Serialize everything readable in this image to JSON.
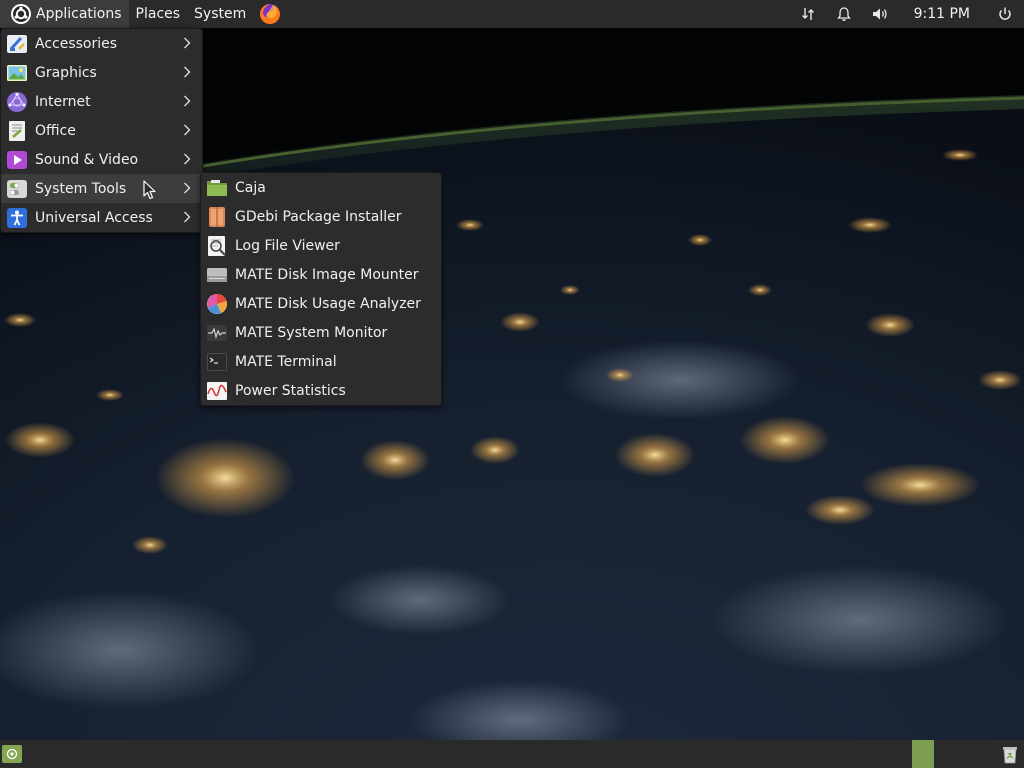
{
  "top_panel": {
    "menus": [
      "Applications",
      "Places",
      "System"
    ],
    "clock": "9:11 PM",
    "tray_icons": [
      "network-icon",
      "notification-bell-icon",
      "volume-icon",
      "power-icon"
    ]
  },
  "applications_menu": {
    "items": [
      {
        "label": "Accessories",
        "icon": "accessories-icon",
        "has_submenu": true
      },
      {
        "label": "Graphics",
        "icon": "graphics-icon",
        "has_submenu": true
      },
      {
        "label": "Internet",
        "icon": "internet-icon",
        "has_submenu": true
      },
      {
        "label": "Office",
        "icon": "office-icon",
        "has_submenu": true
      },
      {
        "label": "Sound & Video",
        "icon": "sound-video-icon",
        "has_submenu": true
      },
      {
        "label": "System Tools",
        "icon": "system-tools-icon",
        "has_submenu": true,
        "highlighted": true
      },
      {
        "label": "Universal Access",
        "icon": "universal-access-icon",
        "has_submenu": true
      }
    ]
  },
  "system_tools_menu": {
    "items": [
      {
        "label": "Caja",
        "icon": "caja-folder-icon"
      },
      {
        "label": "GDebi Package Installer",
        "icon": "package-installer-icon"
      },
      {
        "label": "Log File Viewer",
        "icon": "log-viewer-icon"
      },
      {
        "label": "MATE Disk Image Mounter",
        "icon": "disk-image-mounter-icon"
      },
      {
        "label": "MATE Disk Usage Analyzer",
        "icon": "disk-usage-analyzer-icon"
      },
      {
        "label": "MATE System Monitor",
        "icon": "system-monitor-icon"
      },
      {
        "label": "MATE Terminal",
        "icon": "terminal-icon"
      },
      {
        "label": "Power Statistics",
        "icon": "power-statistics-icon"
      }
    ]
  },
  "colors": {
    "panel_bg": "#2a2a2a",
    "menu_bg": "#2c2c2c",
    "menu_highlight": "#3d3d3d",
    "accent_green": "#84a651"
  }
}
